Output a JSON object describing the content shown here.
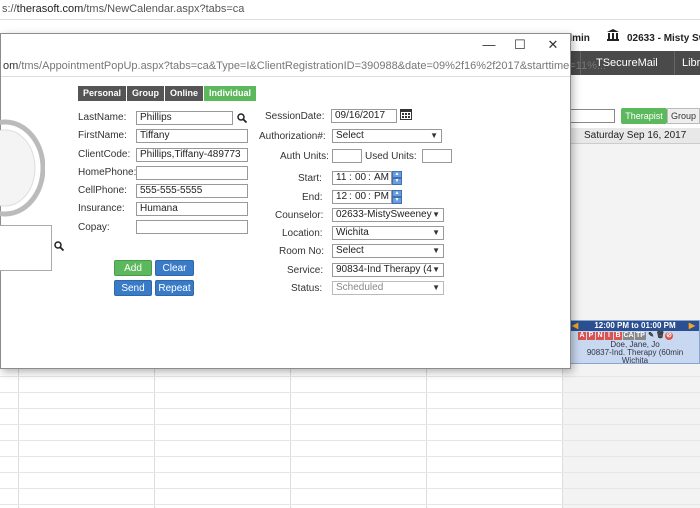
{
  "browser": {
    "url_prefix": "s://",
    "url_domain": "therasoft.com",
    "url_path": "/tms/NewCalendar.aspx?tabs=ca"
  },
  "app": {
    "user_admin": "dmin",
    "user_name": "02633 - Misty Swe",
    "nav": [
      "TSecureMail",
      "Libr"
    ],
    "view_buttons": [
      "Therapist",
      "Group"
    ],
    "day_header": "Saturday Sep 16, 2017",
    "appointment": {
      "time": "12:00 PM to 01:00 PM",
      "badges": [
        "A",
        "P",
        "N",
        "I",
        "B",
        "CA",
        "TP"
      ],
      "client": "Doe, Jane, Jo",
      "service": "90837-Ind. Therapy (60min",
      "location": "Wichita"
    }
  },
  "popup": {
    "window_controls": [
      "—",
      "☐",
      "✕"
    ],
    "url_prefix": "om",
    "url_path": "/tms/AppointmentPopUp.aspx?tabs=ca&Type=I&ClientRegistrationID=390988&date=09%2f16%2f2017&starttime=11%...",
    "tabs": [
      "Personal",
      "Group",
      "Online",
      "Individual"
    ],
    "client": {
      "lastname_label": "LastName:",
      "lastname_value": "Phillips",
      "firstname_label": "FirstName:",
      "firstname_value": "Tiffany",
      "clientcode_label": "ClientCode:",
      "clientcode_value": "Phillips,Tiffany-489773",
      "homephone_label": "HomePhone:",
      "homephone_value": "",
      "cellphone_label": "CellPhone:",
      "cellphone_value": "555-555-5555",
      "insurance_label": "Insurance:",
      "insurance_value": "Humana",
      "copay_label": "Copay:",
      "copay_value": ""
    },
    "buttons": {
      "add": "Add",
      "clear": "Clear",
      "send": "Send",
      "repeat": "Repeat"
    },
    "session": {
      "date_label": "SessionDate:",
      "date_value": "09/16/2017",
      "auth_label": "Authorization#:",
      "auth_value": "Select",
      "auth_units_label": "Auth Units:",
      "auth_units_value": "",
      "used_units_label": "Used Units:",
      "used_units_value": "",
      "start_label": "Start:",
      "start_hour": "11",
      "start_min": "00",
      "start_ampm": "AM",
      "end_label": "End:",
      "end_hour": "12",
      "end_min": "00",
      "end_ampm": "PM",
      "counselor_label": "Counselor:",
      "counselor_value": "02633-MistySweeney",
      "location_label": "Location:",
      "location_value": "Wichita",
      "room_label": "Room No:",
      "room_value": "Select",
      "service_label": "Service:",
      "service_value": "90834-Ind Therapy (4",
      "status_label": "Status:",
      "status_value": "Scheduled"
    }
  },
  "colors": {
    "accent_green": "#5cb85c",
    "tab_dark": "#555555",
    "button_blue": "#3a7bc8",
    "nav_dark": "#4a4a4a",
    "appt_header": "#2b4f91"
  }
}
